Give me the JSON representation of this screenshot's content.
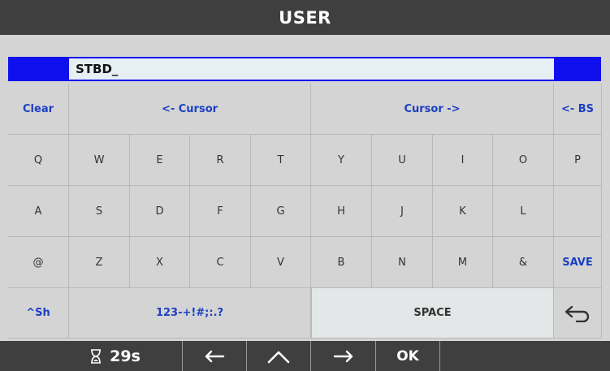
{
  "title": "USER",
  "input": {
    "value": "STBD_"
  },
  "keyboard": {
    "row1": {
      "clear": "Clear",
      "cursor_left": "<- Cursor",
      "cursor_right": "Cursor ->",
      "backspace": "<- BS"
    },
    "row2": [
      "Q",
      "W",
      "E",
      "R",
      "T",
      "Y",
      "U",
      "I",
      "O",
      "P"
    ],
    "row3": [
      "A",
      "S",
      "D",
      "F",
      "G",
      "H",
      "J",
      "K",
      "L"
    ],
    "row4": [
      "@",
      "Z",
      "X",
      "C",
      "V",
      "B",
      "N",
      "M",
      "&"
    ],
    "save": "SAVE",
    "shift": "^Sh",
    "symbols": "123-+!#;:.?",
    "space": "SPACE",
    "enter_icon": "return-arrow-icon"
  },
  "bottombar": {
    "timer_icon": "hourglass-icon",
    "timer_value": "29s",
    "left_icon": "arrow-left-icon",
    "up_icon": "chevron-up-icon",
    "right_icon": "arrow-right-icon",
    "ok": "OK"
  },
  "colors": {
    "accent": "#1010ee",
    "key_text_blue": "#1a3fc4",
    "bar": "#3f3f3f",
    "key_bg": "#d4d4d4"
  }
}
